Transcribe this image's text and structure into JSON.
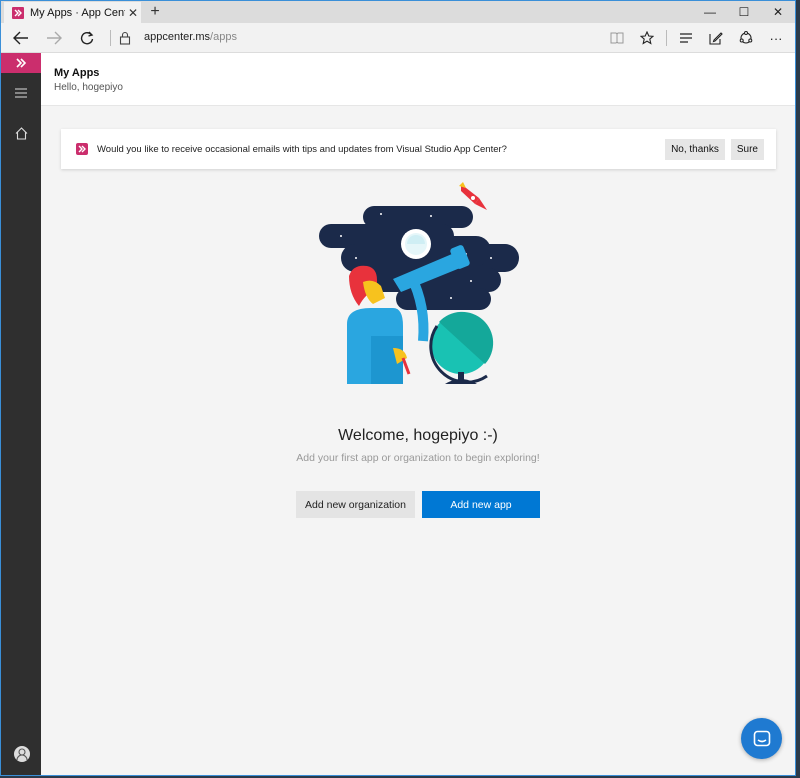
{
  "browser": {
    "tab_title": "My Apps · App Center",
    "tab_close": "✕",
    "new_tab": "+",
    "url_host": "appcenter.ms",
    "url_path": "/apps",
    "window_controls": {
      "minimize": "—",
      "maximize": "☐",
      "close": "✕"
    },
    "more_label": "···"
  },
  "header": {
    "title": "My Apps",
    "subtitle": "Hello, hogepiyo"
  },
  "banner": {
    "text": "Would you like to receive occasional emails with tips and updates from Visual Studio App Center?",
    "decline_label": "No, thanks",
    "accept_label": "Sure"
  },
  "main": {
    "welcome": "Welcome, hogepiyo :-)",
    "subtext": "Add your first app or organization to begin exploring!",
    "add_org_label": "Add new organization",
    "add_app_label": "Add new app"
  },
  "colors": {
    "brand": "#cb2e6d",
    "primary": "#0078d4",
    "rail": "#2f2f2f",
    "night_sky": "#1b2a4a"
  },
  "icons": [
    "back-icon",
    "forward-icon",
    "refresh-icon",
    "lock-icon",
    "reading-view-icon",
    "favorite-star-icon",
    "hub-icon",
    "notes-icon",
    "share-icon",
    "more-icon",
    "menu-icon",
    "home-icon",
    "avatar-icon",
    "chat-icon"
  ]
}
